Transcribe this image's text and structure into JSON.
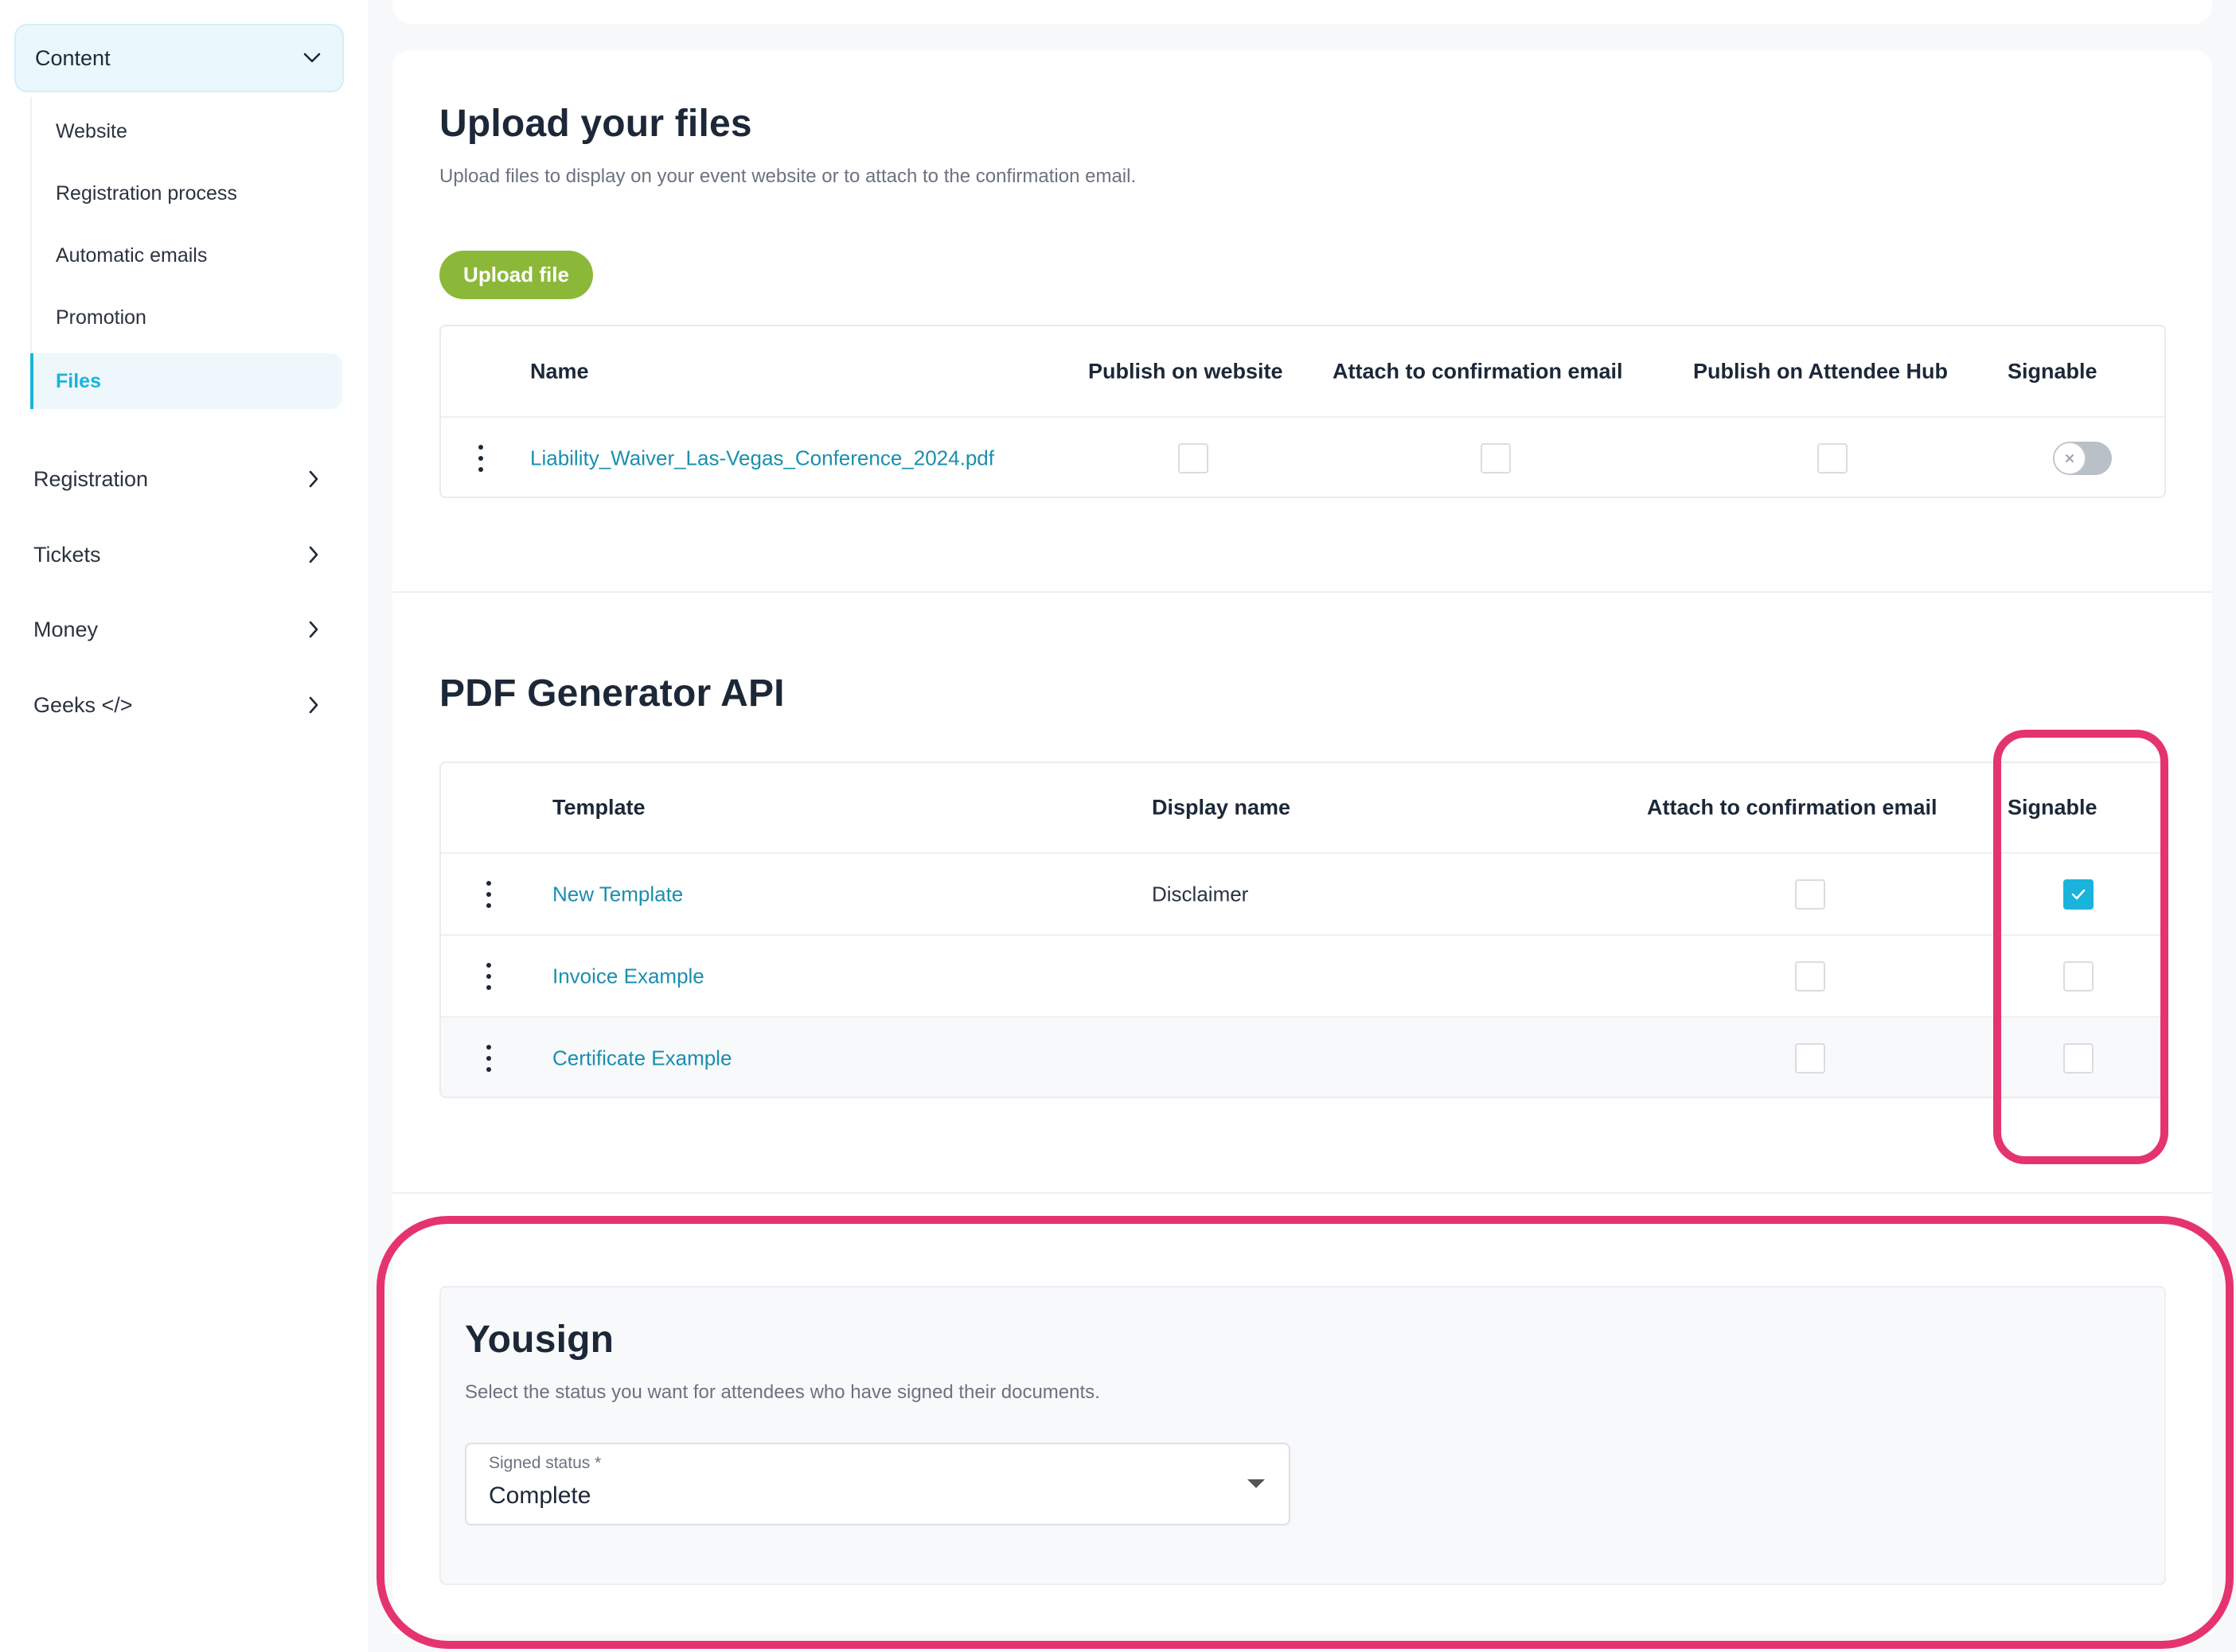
{
  "sidebar": {
    "content_group": {
      "label": "Content",
      "expanded": true
    },
    "content_items": [
      {
        "label": "Website",
        "active": false
      },
      {
        "label": "Registration process",
        "active": false
      },
      {
        "label": "Automatic emails",
        "active": false
      },
      {
        "label": "Promotion",
        "active": false
      },
      {
        "label": "Files",
        "active": true
      }
    ],
    "groups": [
      {
        "label": "Registration"
      },
      {
        "label": "Tickets"
      },
      {
        "label": "Money"
      },
      {
        "label": "Geeks </>"
      }
    ]
  },
  "upload_section": {
    "title": "Upload your files",
    "subtitle": "Upload files to display on your event website or to attach to the confirmation email.",
    "upload_button": "Upload file",
    "table": {
      "headers": {
        "name": "Name",
        "publish_website": "Publish on website",
        "attach_email": "Attach to confirmation email",
        "publish_hub": "Publish on Attendee Hub",
        "signable": "Signable"
      },
      "rows": [
        {
          "name": "Liability_Waiver_Las-Vegas_Conference_2024.pdf",
          "publish_website": false,
          "attach_email": false,
          "publish_hub": false,
          "signable": false
        }
      ]
    }
  },
  "pdf_section": {
    "title": "PDF Generator API",
    "table": {
      "headers": {
        "template": "Template",
        "display_name": "Display name",
        "attach_email": "Attach to confirmation email",
        "signable": "Signable"
      },
      "rows": [
        {
          "template": "New Template",
          "display_name": "Disclaimer",
          "attach_email": false,
          "signable": true
        },
        {
          "template": "Invoice Example",
          "display_name": "",
          "attach_email": false,
          "signable": false
        },
        {
          "template": "Certificate Example",
          "display_name": "",
          "attach_email": false,
          "signable": false
        }
      ]
    }
  },
  "yousign_section": {
    "title": "Yousign",
    "subtitle": "Select the status you want for attendees who have signed their documents.",
    "signed_status": {
      "label": "Signed status *",
      "value": "Complete"
    }
  },
  "colors": {
    "accent": "#1ab3dc",
    "link": "#1a8fb0",
    "upload_button": "#8cb83a",
    "annotation": "#e5336f"
  },
  "icons": {
    "content_chevron": "chevron-down-icon",
    "group_chevron": "chevron-right-icon",
    "row_menu": "kebab-menu-icon",
    "checkbox_check": "check-icon",
    "toggle_off": "x-icon",
    "select_caret": "caret-down-icon"
  }
}
